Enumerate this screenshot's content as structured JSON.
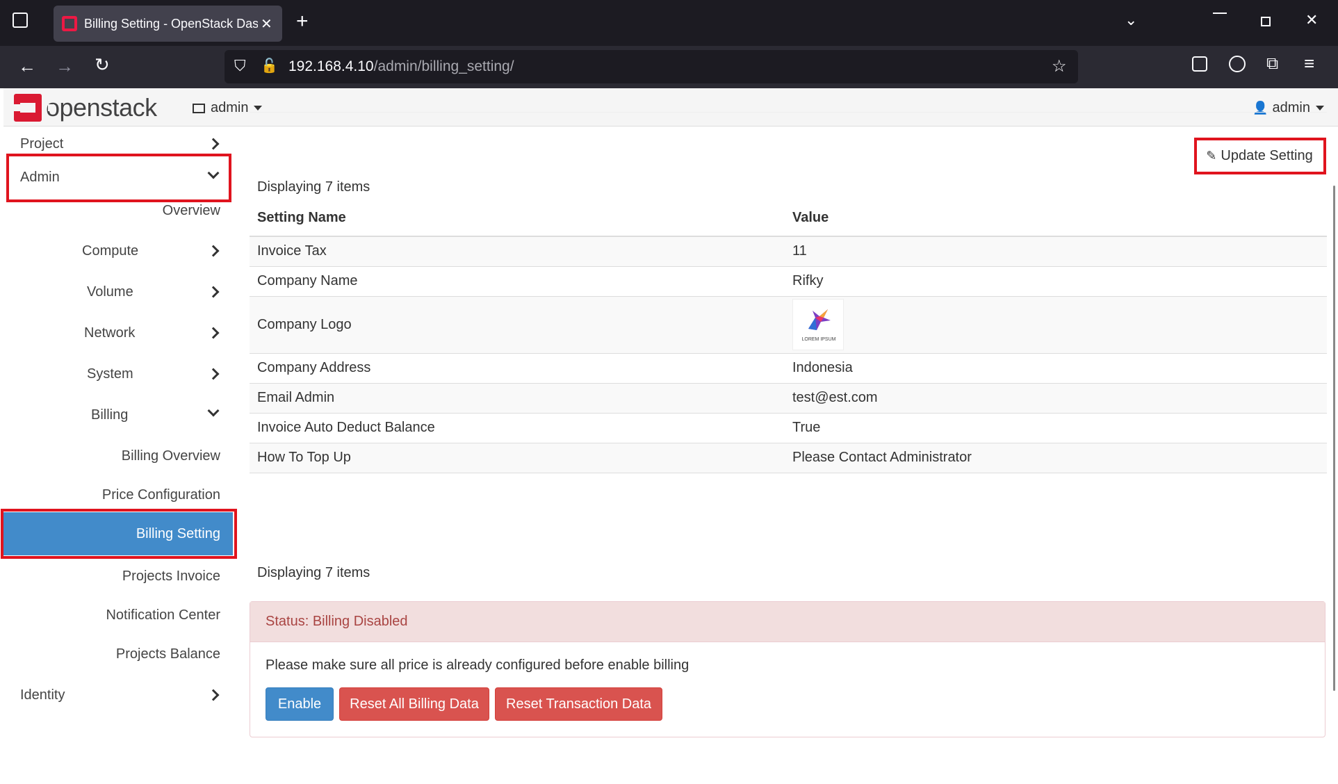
{
  "browser": {
    "tab_title": "Billing Setting - OpenStack Dashboard",
    "url_host": "192.168.4.10",
    "url_path": "/admin/billing_setting/"
  },
  "header": {
    "logo_text": "openstack",
    "project_label": "admin",
    "user_label": "admin"
  },
  "sidebar": {
    "project": "Project",
    "admin": "Admin",
    "overview": "Overview",
    "compute": "Compute",
    "volume": "Volume",
    "network": "Network",
    "system": "System",
    "billing": "Billing",
    "billing_overview": "Billing Overview",
    "price_configuration": "Price Configuration",
    "billing_setting": "Billing Setting",
    "projects_invoice": "Projects Invoice",
    "notification_center": "Notification Center",
    "projects_balance": "Projects Balance",
    "identity": "Identity"
  },
  "main": {
    "update_button": "Update Setting",
    "displaying": "Displaying 7 items",
    "columns": [
      "Setting Name",
      "Value"
    ],
    "rows": [
      {
        "name": "Invoice Tax",
        "value": "11"
      },
      {
        "name": "Company Name",
        "value": "Rifky"
      },
      {
        "name": "Company Logo",
        "value": "LOREM IPSUM"
      },
      {
        "name": "Company Address",
        "value": "Indonesia"
      },
      {
        "name": "Email Admin",
        "value": "test@est.com"
      },
      {
        "name": "Invoice Auto Deduct Balance",
        "value": "True"
      },
      {
        "name": "How To Top Up",
        "value": "Please Contact Administrator"
      }
    ]
  },
  "status": {
    "heading": "Status: Billing Disabled",
    "message": "Please make sure all price is already configured before enable billing",
    "enable": "Enable",
    "reset_all": "Reset All Billing Data",
    "reset_transaction": "Reset Transaction Data"
  },
  "colors": {
    "active_item": "#428bca",
    "highlight_box": "#e0141e",
    "danger": "#d9534f"
  }
}
